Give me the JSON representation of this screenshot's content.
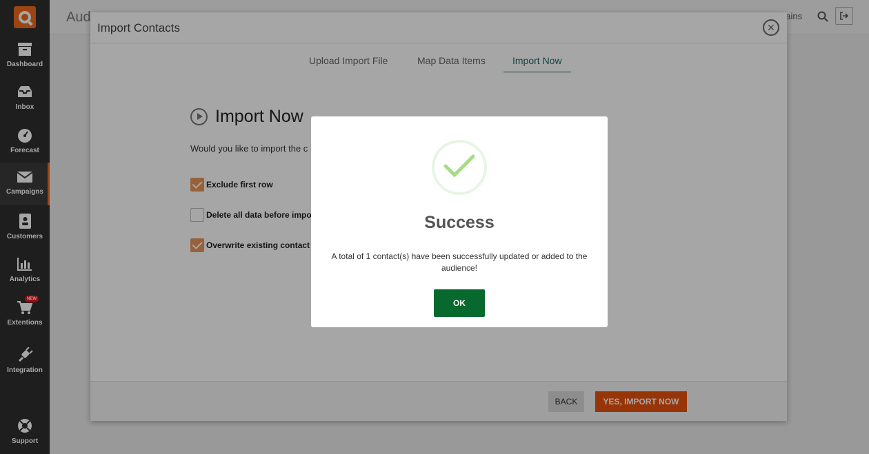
{
  "sidebar": {
    "items": [
      {
        "label": "Dashboard",
        "icon": "archive-box-icon"
      },
      {
        "label": "Inbox",
        "icon": "inbox-tray-icon"
      },
      {
        "label": "Forecast",
        "icon": "speedometer-icon"
      },
      {
        "label": "Campaigns",
        "icon": "envelope-icon"
      },
      {
        "label": "Customers",
        "icon": "contact-book-icon"
      },
      {
        "label": "Analytics",
        "icon": "bar-chart-icon"
      },
      {
        "label": "Extentions",
        "icon": "shopping-cart-icon"
      },
      {
        "label": "Integration",
        "icon": "plug-icon"
      },
      {
        "label": "Support",
        "icon": "lifebuoy-icon"
      }
    ],
    "new_badge": "NEW",
    "accent": "#f06a1d"
  },
  "topbar": {
    "title": "Aud",
    "right_text": "nains"
  },
  "import_modal": {
    "title": "Import Contacts",
    "tabs": [
      "Upload Import File",
      "Map Data Items",
      "Import Now"
    ],
    "active_tab": "Import Now",
    "heading": "Import Now",
    "question": "Would you like to import the c",
    "options": [
      {
        "label": "Exclude first row",
        "checked": true
      },
      {
        "label": "Delete all data before impor",
        "checked": false
      },
      {
        "label": "Overwrite existing contact",
        "checked": true
      }
    ],
    "back_label": "BACK",
    "import_label": "YES, IMPORT NOW"
  },
  "success_dialog": {
    "title": "Success",
    "message": "A total of 1 contact(s) have been successfully updated or added to the audience!",
    "ok_label": "OK",
    "check_color": "#a5dc86",
    "ok_color": "#08692f"
  }
}
